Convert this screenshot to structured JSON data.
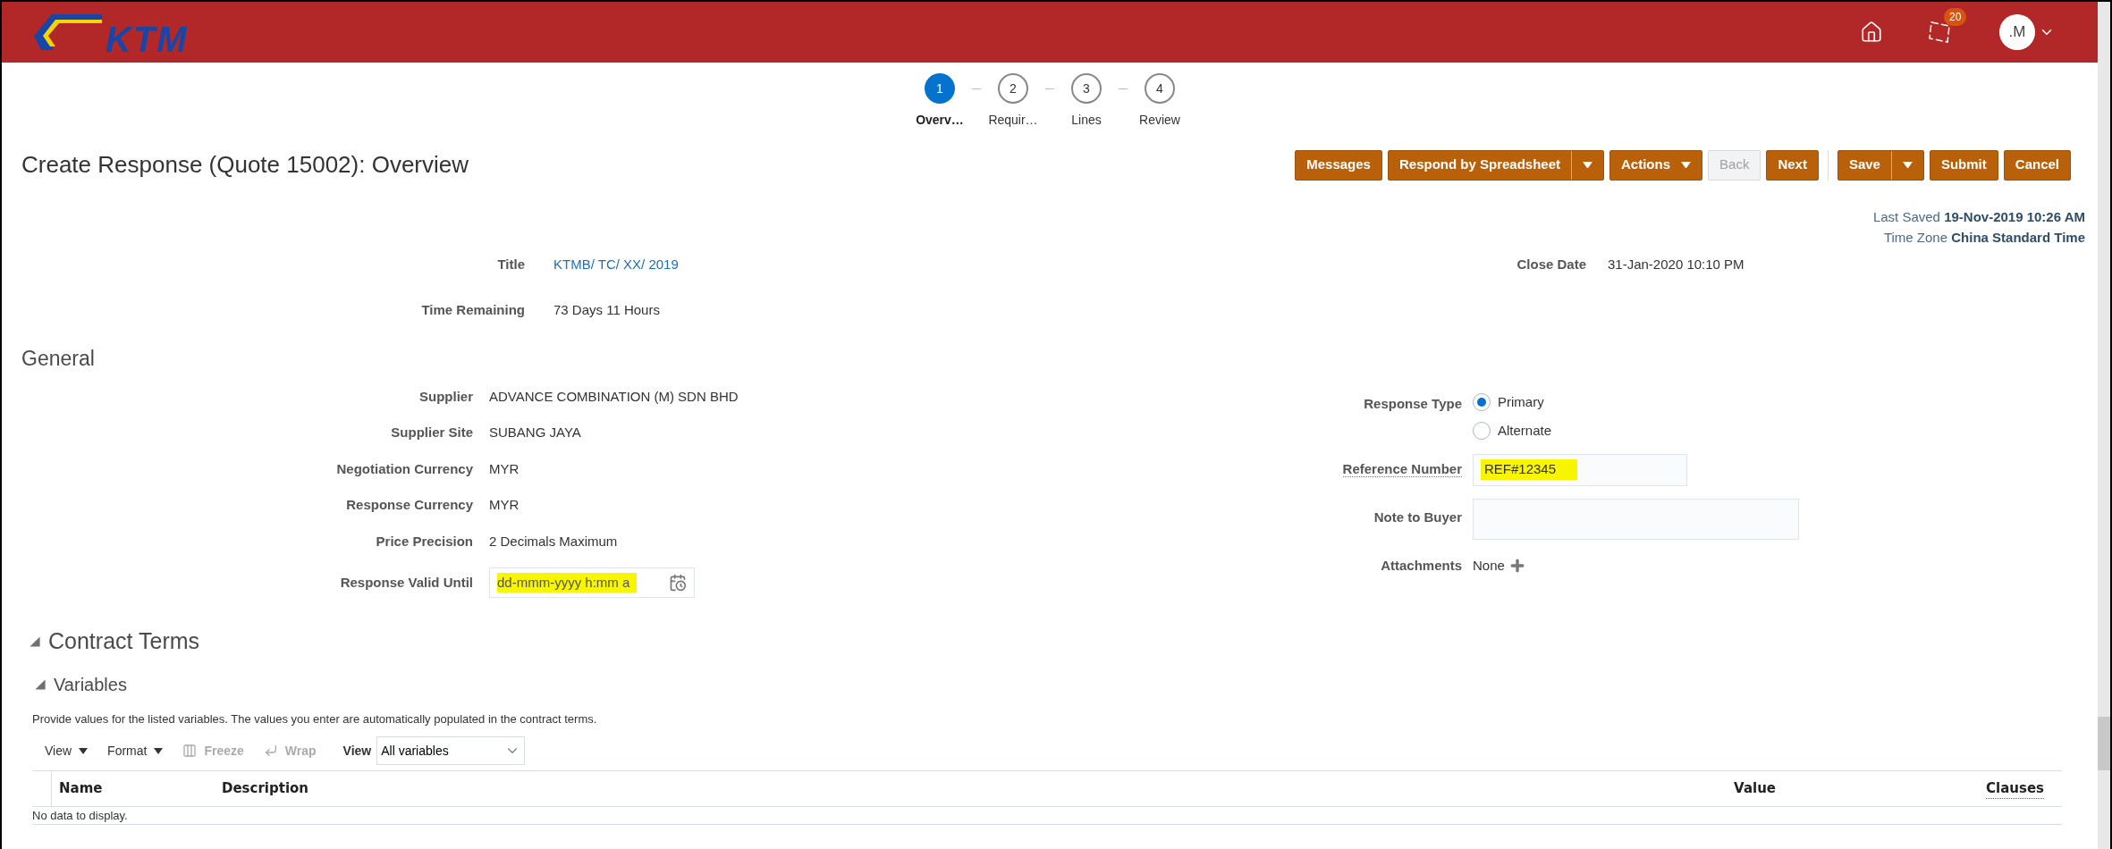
{
  "header": {
    "logo": "KTM",
    "notifications": {
      "count": "20"
    },
    "user": {
      "initials": ".M"
    }
  },
  "train": [
    {
      "number": "1",
      "label": "Overv…",
      "selected": true
    },
    {
      "number": "2",
      "label": "Requir…",
      "selected": false
    },
    {
      "number": "3",
      "label": "Lines",
      "selected": false
    },
    {
      "number": "4",
      "label": "Review",
      "selected": false
    }
  ],
  "page_title": "Create Response (Quote 15002): Overview",
  "buttons": [
    {
      "label": "Messages",
      "kind": "plain",
      "disabled": false
    },
    {
      "label": "Respond by Spreadsheet",
      "kind": "split",
      "disabled": false
    },
    {
      "label": "Actions",
      "kind": "menu",
      "disabled": false
    },
    {
      "label": "Back",
      "kind": "plain",
      "disabled": true
    },
    {
      "label": "Next",
      "kind": "plain",
      "disabled": false
    },
    {
      "label": "Save",
      "kind": "split",
      "disabled": false
    },
    {
      "label": "Submit",
      "kind": "plain",
      "disabled": false
    },
    {
      "label": "Cancel",
      "kind": "plain",
      "disabled": false
    }
  ],
  "last_saved": {
    "label": "Last Saved",
    "value": "19-Nov-2019 10:26 AM"
  },
  "time_zone": {
    "label": "Time Zone",
    "value": "China Standard Time"
  },
  "summary": [
    {
      "label": "Title",
      "value": "KTMB/ TC/ XX/ 2019",
      "kind": "link"
    },
    {
      "label": "Time Remaining",
      "value": "73 Days 11 Hours",
      "kind": "text"
    }
  ],
  "close_date": {
    "label": "Close Date",
    "value": "31-Jan-2020 10:10 PM"
  },
  "general": {
    "title": "General",
    "left": [
      {
        "label": "Supplier",
        "value": "ADVANCE COMBINATION (M) SDN BHD",
        "kind": "text"
      },
      {
        "label": "Supplier Site",
        "value": "SUBANG JAYA",
        "kind": "text"
      },
      {
        "label": "Negotiation Currency",
        "value": "MYR",
        "kind": "text"
      },
      {
        "label": "Response Currency",
        "value": "MYR",
        "kind": "text"
      },
      {
        "label": "Price Precision",
        "value": "2 Decimals Maximum",
        "kind": "text"
      },
      {
        "label": "Response Valid Until",
        "placeholder": "dd-mmm-yyyy h:mm a",
        "kind": "date",
        "highlighted": true
      }
    ],
    "response_type": {
      "label": "Response Type",
      "options": [
        {
          "label": "Primary",
          "selected": true
        },
        {
          "label": "Alternate",
          "selected": false
        }
      ]
    },
    "reference_number": {
      "label": "Reference Number",
      "value": "REF#12345",
      "highlighted": true
    },
    "note_to_buyer": {
      "label": "Note to Buyer"
    },
    "attachments": {
      "label": "Attachments",
      "value": "None"
    }
  },
  "contract_terms": {
    "title": "Contract Terms",
    "expanded": true,
    "variables": {
      "title": "Variables",
      "expanded": true,
      "description": "Provide values for the listed variables. The values you enter are automatically populated in the contract terms.",
      "toolbar": [
        {
          "label": "View",
          "kind": "menu",
          "disabled": false
        },
        {
          "label": "Format",
          "kind": "menu",
          "disabled": false
        },
        {
          "label": "Freeze",
          "kind": "freeze",
          "disabled": true
        },
        {
          "label": "Wrap",
          "kind": "wrap",
          "disabled": true
        }
      ],
      "view_filter": {
        "label": "View",
        "value": "All variables"
      },
      "columns": [
        "Name",
        "Description",
        "Value",
        "Clauses"
      ],
      "empty_text": "No data to display."
    }
  }
}
